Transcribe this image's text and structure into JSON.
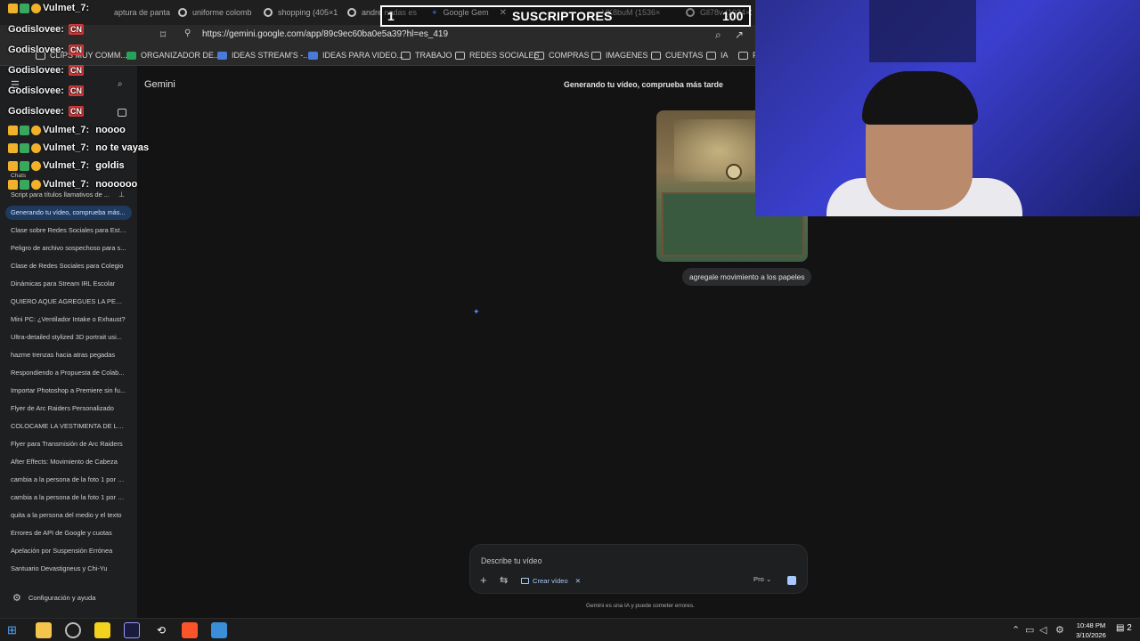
{
  "browser": {
    "tabs": [
      {
        "label": "aptura de panta"
      },
      {
        "label": "uniforme colomb"
      },
      {
        "label": "shopping (405×1"
      },
      {
        "label": "andre nadas es"
      },
      {
        "label": "Google Gem"
      },
      {
        "label": "VK8buM (1536×"
      },
      {
        "label": "Gll78v (1024×1"
      }
    ],
    "url": "https://gemini.google.com/app/89c9ec60ba0e5a39?hl=es_419",
    "bookmarks": [
      {
        "label": "CLIPS MUY COMM..."
      },
      {
        "label": "ORGANIZADOR DE..."
      },
      {
        "label": "IDEAS STREAM'S -..."
      },
      {
        "label": "IDEAS PARA VIDEO..."
      },
      {
        "label": "TRABAJO"
      },
      {
        "label": "REDES SOCIALES"
      },
      {
        "label": "COMPRAS"
      },
      {
        "label": "IMAGENES"
      },
      {
        "label": "CUENTAS"
      },
      {
        "label": "IA"
      },
      {
        "label": "F"
      }
    ]
  },
  "sidebar": {
    "chats": [
      "Script para títulos llamativos de ...",
      "Generando tu vídeo, comprueba más...",
      "Clase sobre Redes Sociales para Estu...",
      "Peligro de archivo sospechoso para s...",
      "Clase de Redes Sociales para Colegio",
      "Dinámicas para Stream IRL Escolar",
      "QUIERO AQUE AGREGUES LA PERON...",
      "Mini PC: ¿Ventilador Intake o Exhaust?",
      "Ultra-detailed stylized 3D portrait usi...",
      "hazme trenzas hacia atras pegadas",
      "Respondiendo a Propuesta de Colab...",
      "Importar Photoshop a Premiere sin fu...",
      "Flyer de Arc Raiders Personalizado",
      "COLOCAME LA VESTIMENTA DE LA I...",
      "Flyer para Transmisión de Arc Raiders",
      "After Effects: Movimiento de Cabeza",
      "cambia a la persona de la foto 1 por e...",
      "cambia a la persona de la foto 1 por e...",
      "quita a la persona del medio y el texto",
      "Errores de API de Google y cuotas",
      "Apelación por Suspensión Errónea",
      "Santuario Devastigneus y Chi-Yu"
    ],
    "chats_heading": "Chats",
    "settings_label": "Configuración y ayuda"
  },
  "main": {
    "app_title": "Gemini",
    "conversation_title": "Generando tu vídeo, comprueba más tarde",
    "user_message": "agregale movimiento a los papeles",
    "input_placeholder": "Describe tu vídeo",
    "chip_label": "Crear vídeo",
    "model_label": "Pro",
    "disclaimer": "Gemini es una IA y puede cometer errores."
  },
  "chat_overlay": [
    {
      "user": "Vulmet_7:",
      "message": "",
      "badges": "crown"
    },
    {
      "user": "Godislovee:",
      "message": "CN",
      "badges": "cn"
    },
    {
      "user": "Godislovee:",
      "message": "CN",
      "badges": "cn"
    },
    {
      "user": "Godislovee:",
      "message": "CN",
      "badges": "cn"
    },
    {
      "user": "Godislovee:",
      "message": "CN",
      "badges": "cn"
    },
    {
      "user": "Godislovee:",
      "message": "CN",
      "badges": "cn"
    },
    {
      "user": "Vulmet_7:",
      "message": "noooo",
      "badges": "crown"
    },
    {
      "user": "Vulmet_7:",
      "message": "no te vayas",
      "badges": "crown"
    },
    {
      "user": "Vulmet_7:",
      "message": "goldis",
      "badges": "crown"
    },
    {
      "user": "Vulmet_7:",
      "message": "noooooo",
      "badges": "crown"
    }
  ],
  "subscriber_goal": {
    "current": "1",
    "label": "SUSCRIPTORES",
    "target": "100"
  },
  "taskbar": {
    "time": "10:48 PM",
    "date": "3/10/2026",
    "notifications": "2"
  },
  "colors": {
    "background": "#131314",
    "sidebar": "#1e1f20",
    "active_chat": "#1e3a5f",
    "accent": "#a8c7fa",
    "cn_badge": "#d83a3a"
  }
}
